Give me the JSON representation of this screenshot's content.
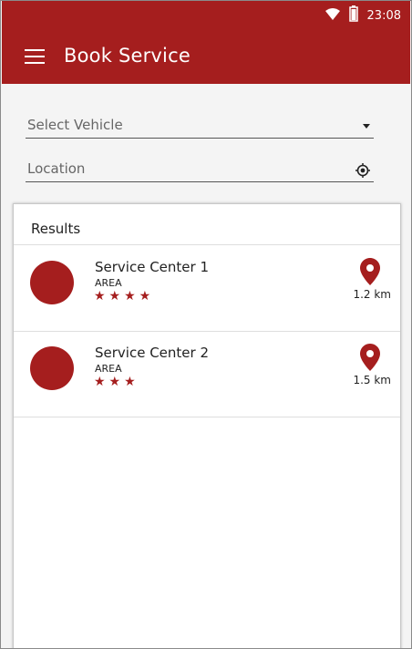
{
  "status_bar": {
    "time": "23:08"
  },
  "app_bar": {
    "title": "Book Service"
  },
  "form": {
    "vehicle_placeholder": "Select Vehicle",
    "location_placeholder": "Location"
  },
  "results": {
    "title": "Results",
    "items": [
      {
        "name": "Service Center 1",
        "area": "AREA",
        "rating": 4,
        "stars": "★★★★",
        "distance": "1.2 km"
      },
      {
        "name": "Service Center 2",
        "area": "AREA",
        "rating": 3,
        "stars": "★★★",
        "distance": "1.5 km"
      }
    ]
  },
  "colors": {
    "brand": "#a51e1e",
    "background": "#f4f4f4",
    "card": "#ffffff"
  },
  "icons": [
    "wifi-icon",
    "battery-icon",
    "menu-icon",
    "dropdown-caret-icon",
    "locate-icon",
    "map-pin-icon"
  ]
}
